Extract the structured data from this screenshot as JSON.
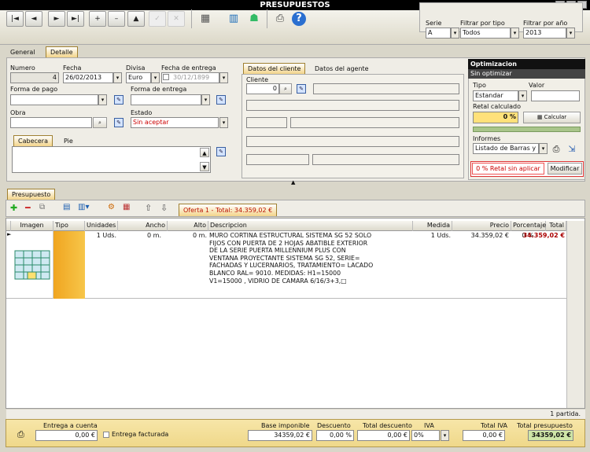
{
  "window": {
    "title": "PRESUPUESTOS"
  },
  "toolbar": {
    "buttons": [
      "|◄",
      "◄",
      "►",
      "►|",
      "+",
      "–",
      "▲",
      "✓",
      "✕"
    ]
  },
  "filters": {
    "serie_label": "Serie",
    "serie_value": "A",
    "tipo_label": "Filtrar por tipo",
    "tipo_value": "Todos",
    "anio_label": "Filtrar por año",
    "anio_value": "2013"
  },
  "tabs": {
    "general": "General",
    "detalle": "Detalle"
  },
  "detalle": {
    "numero_label": "Numero",
    "numero_value": "4",
    "fecha_label": "Fecha",
    "fecha_value": "26/02/2013",
    "divisa_label": "Divisa",
    "divisa_value": "Euro",
    "fecha_entrega_label": "Fecha de entrega",
    "fecha_entrega_value": "30/12/1899",
    "forma_pago_label": "Forma de pago",
    "forma_entrega_label": "Forma de entrega",
    "obra_label": "Obra",
    "estado_label": "Estado",
    "estado_value": "Sin aceptar",
    "cabecera_tab": "Cabecera",
    "pie_tab": "Pie"
  },
  "cliente": {
    "tab_cliente": "Datos del cliente",
    "tab_agente": "Datos del agente",
    "cliente_label": "Cliente",
    "cliente_value": "0"
  },
  "optimizacion": {
    "title": "Optimizacion",
    "subtitle": "Sin optimizar",
    "tipo_label": "Tipo",
    "valor_label": "Valor",
    "tipo_value": "Estandar",
    "retal_label": "Retal calculado",
    "retal_value": "0 %",
    "calcular": "Calcular",
    "informes_label": "Informes",
    "informes_value": "Listado de Barras y",
    "retal_status": "0 % Retal sin aplicar",
    "modificar": "Modificar"
  },
  "presupuesto": {
    "tab": "Presupuesto",
    "oferta": "Oferta 1 - Total: 34.359,02 €"
  },
  "grid": {
    "headers": {
      "imagen": "Imagen",
      "tipo": "Tipo",
      "unidades": "Unidades",
      "ancho": "Ancho",
      "alto": "Alto",
      "descripcion": "Descripcion",
      "medida": "Medida",
      "precio": "Precio",
      "porcentaje": "Porcentaje",
      "total": "Total"
    },
    "row": {
      "unidades": "1 Uds.",
      "ancho": "0 m.",
      "alto": "0 m.",
      "descripcion": "MURO CORTINA ESTRUCTURAL SISTEMA SG 52 SOLO FIJOS CON PUERTA DE 2 HOJAS ABATIBLE EXTERIOR DE LA SERIE PUERTA MILLENNIUM PLUS CON VENTANA PROYECTANTE SISTEMA SG 52, SERIE= FACHADAS Y LUCERNARIOS, TRATAMIENTO= LACADO BLANCO RAL= 9010. MEDIDAS: H1=15000 V1=15000 , VIDRIO DE CAMARA 6/16/3+3,□",
      "medida": "1 Uds.",
      "precio": "34.359,02 €",
      "porcentaje": "0 %",
      "total": "34.359,02 €"
    },
    "count": "1 partida."
  },
  "footer": {
    "entrega_label": "Entrega a cuenta",
    "entrega_value": "0,00 €",
    "entrega_facturada": "Entrega facturada",
    "base_label": "Base imponible",
    "base_value": "34359,02 €",
    "descuento_label": "Descuento",
    "descuento_value": "0,00 %",
    "total_desc_label": "Total descuento",
    "total_desc_value": "0,00 €",
    "iva_label": "IVA",
    "iva_value": "0%",
    "total_iva_label": "Total IVA",
    "total_iva_value": "0,00 €",
    "total_pres_label": "Total presupuesto",
    "total_pres_value": "34359,02 €"
  }
}
